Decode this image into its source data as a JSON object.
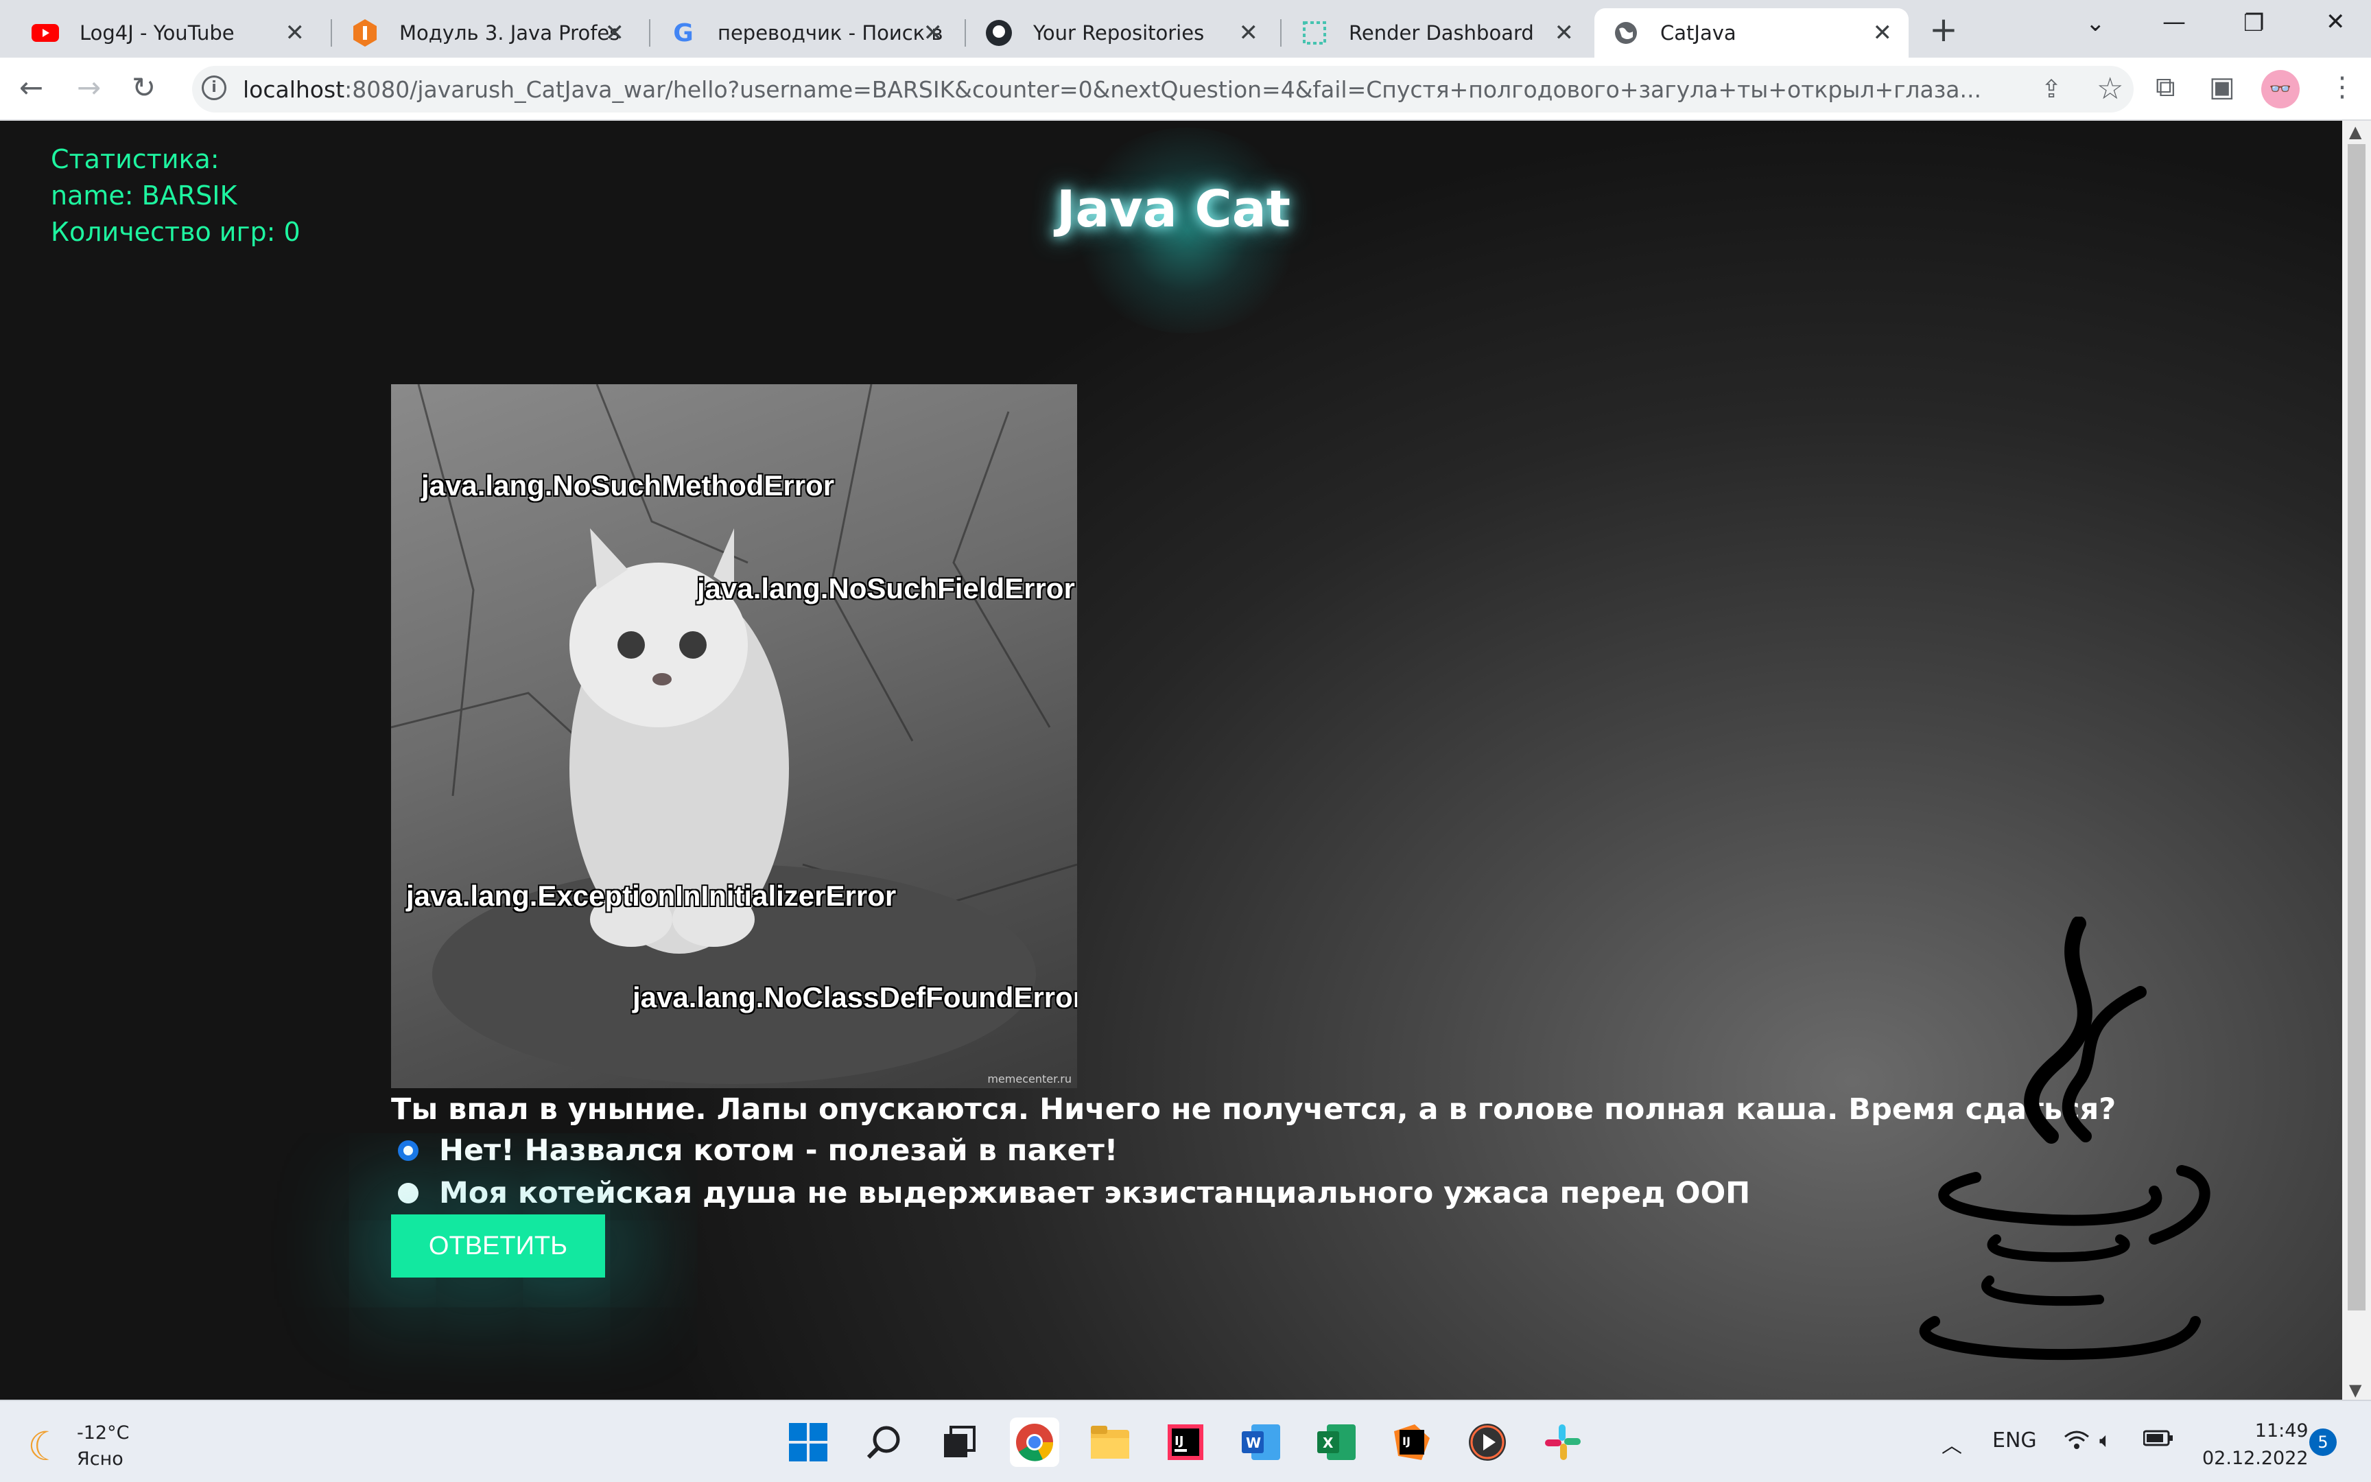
{
  "browser": {
    "tabs": [
      {
        "title": "Log4J - YouTube",
        "icon": "youtube-icon"
      },
      {
        "title": "Модуль 3. Java Profes",
        "icon": "javarush-icon"
      },
      {
        "title": "переводчик - Поиск в",
        "icon": "google-icon"
      },
      {
        "title": "Your Repositories",
        "icon": "github-icon"
      },
      {
        "title": "Render Dashboard",
        "icon": "render-icon"
      },
      {
        "title": "CatJava",
        "icon": "globe-icon",
        "active": true
      }
    ],
    "url_host": "localhost",
    "url_rest": ":8080/javarush_CatJava_war/hello?username=BARSIK&counter=0&nextQuestion=4&fail=Спустя+полгодового+загула+ты+открыл+глаза..."
  },
  "page": {
    "stats": {
      "heading": "Статистика:",
      "name_line": "name: BARSIK",
      "games_line": "Количество игр: 0"
    },
    "title": "Java Cat",
    "image_captions": [
      "java.lang.NoSuchMethodError",
      "java.lang.NoSuchFieldError",
      "java.lang.ExceptionInInitializerError",
      "java.lang.NoClassDefFoundError"
    ],
    "image_watermark": "memecenter.ru",
    "question": "Ты впал в уныние. Лапы опускаются. Ничего не получется, а в голове полная каша. Время сдаться?",
    "options": [
      {
        "label": "Нет! Назвался котом - полезай в пакет!",
        "selected": true
      },
      {
        "label": "Моя котейская душа не выдерживает экзистанциального ужаса перед ООП",
        "selected": false
      }
    ],
    "submit_label": "ОТВЕТИТЬ",
    "accent_color": "#12e8a0"
  },
  "taskbar": {
    "weather_temp": "-12°C",
    "weather_desc": "Ясно",
    "lang": "ENG",
    "time": "11:49",
    "date": "02.12.2022",
    "notifications": "5"
  }
}
